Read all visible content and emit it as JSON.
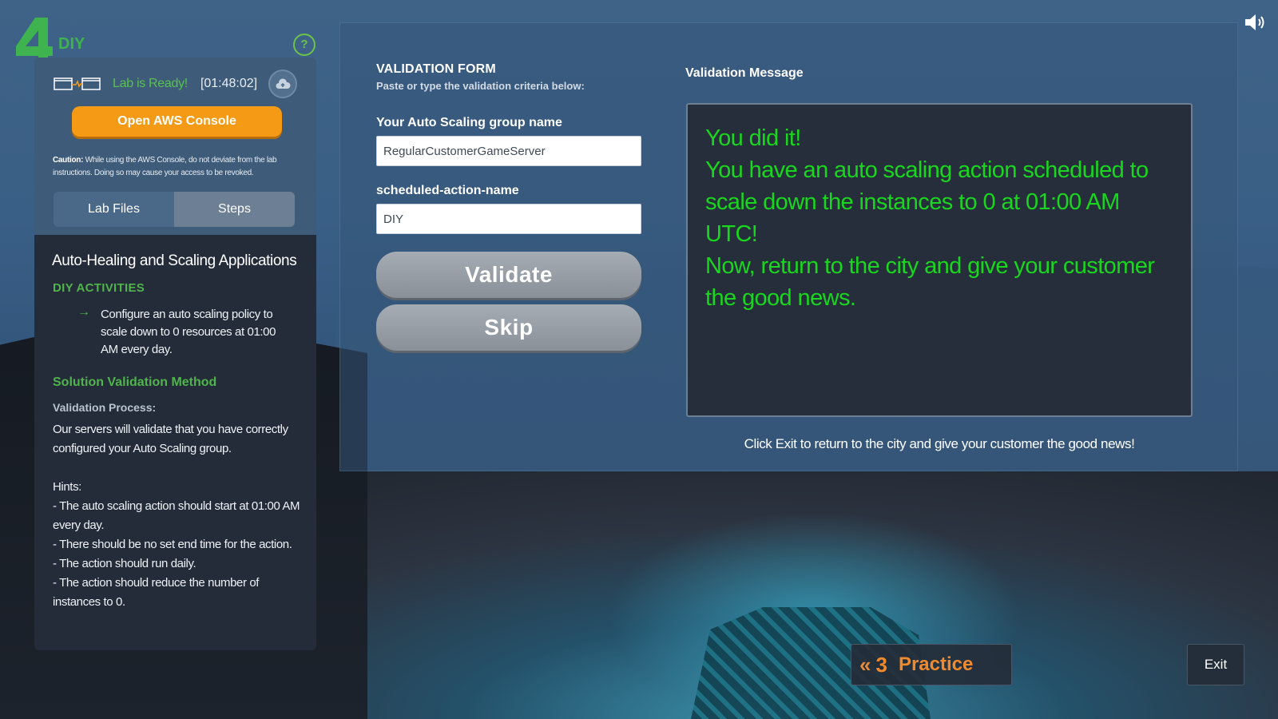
{
  "level": {
    "number": "4",
    "title": "DIY",
    "badge_color": "#3fb34f"
  },
  "lab": {
    "status": "Lab is Ready!",
    "timer": "[01:48:02]",
    "open_console_label": "Open AWS Console",
    "caution_label": "Caution:",
    "caution_text": "While using the AWS Console, do not deviate from the lab instructions. Doing so may cause your access to be revoked."
  },
  "tabs": [
    {
      "label": "Lab Files"
    },
    {
      "label": "Steps"
    }
  ],
  "steps_panel": {
    "course_title": "Auto-Healing and Scaling Applications",
    "activities_heading": "DIY ACTIVITIES",
    "activity": "Configure an auto scaling policy to scale down to 0 resources at 01:00 AM every day.",
    "solution_heading": "Solution Validation Method",
    "process_heading": "Validation Process:",
    "process_text": "Our servers will validate that you have correctly configured your Auto Scaling group.",
    "hints_heading": "Hints:",
    "hints": [
      "- The auto scaling action should start at 01:00 AM every day.",
      "- There should be no set end time for the action.",
      "- The action should run daily.",
      "- The action should reduce the number of instances to 0."
    ]
  },
  "validation_form": {
    "title": "VALIDATION FORM",
    "subtitle": "Paste or type the validation criteria below:",
    "fields": [
      {
        "label": "Your Auto Scaling group name",
        "value": "RegularCustomerGameServer"
      },
      {
        "label": "scheduled-action-name",
        "value": "DIY"
      }
    ],
    "validate_label": "Validate",
    "skip_label": "Skip"
  },
  "validation_message": {
    "title": "Validation Message",
    "lines": [
      "You did it!",
      "You have an auto scaling action scheduled to scale down the instances to 0 at 01:00 AM UTC!",
      "Now, return to the city and give your customer the good news."
    ],
    "text_color": "#19d61e",
    "exit_note": "Click Exit to return to the city and give your customer the good news!"
  },
  "footer": {
    "practice_number": "3",
    "practice_label": "Practice",
    "exit_label": "Exit"
  },
  "icons": {
    "speaker": "speaker-icon",
    "help": "help-icon",
    "cloud": "cloud-upload-icon",
    "connection": "connection-windows-icon",
    "arrow": "arrow-right-icon",
    "back": "double-chevron-left-icon"
  },
  "colors": {
    "accent_orange": "#f59a14",
    "accent_green": "#4fb44a"
  }
}
